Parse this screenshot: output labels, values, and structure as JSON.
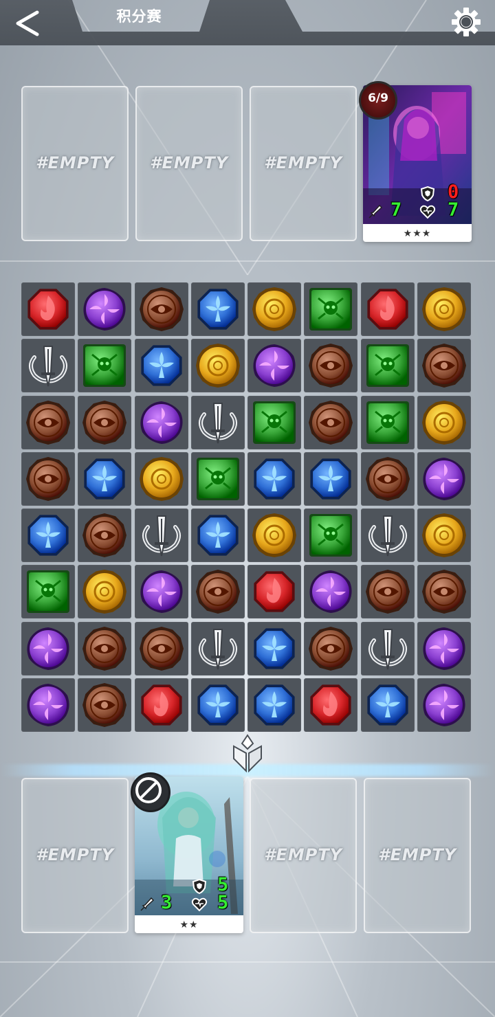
{
  "header": {
    "title": "积分赛"
  },
  "enemy_row": {
    "slots": [
      {
        "type": "empty",
        "label": "#EMPTY"
      },
      {
        "type": "empty",
        "label": "#EMPTY"
      },
      {
        "type": "empty",
        "label": "#EMPTY"
      },
      {
        "type": "card",
        "level": "6/9",
        "shield": "0",
        "attack": "7",
        "hp": "7",
        "stars": "★★★"
      }
    ]
  },
  "player_row": {
    "slots": [
      {
        "type": "empty",
        "label": "#EMPTY"
      },
      {
        "type": "card",
        "status": "disabled",
        "shield": "5",
        "attack": "3",
        "hp": "5",
        "stars": "★★"
      },
      {
        "type": "empty",
        "label": "#EMPTY"
      },
      {
        "type": "empty",
        "label": "#EMPTY"
      }
    ]
  },
  "board": {
    "columns": 8,
    "rows": 8,
    "gems": [
      [
        "red-fire",
        "purple-swirl",
        "brown-eye",
        "blue-flower",
        "yellow-sun",
        "green-skull",
        "red-fire",
        "yellow-sun"
      ],
      [
        "silver-sword",
        "green-skull",
        "blue-flower",
        "yellow-sun",
        "purple-swirl",
        "brown-eye",
        "green-skull",
        "brown-eye"
      ],
      [
        "brown-eye",
        "brown-eye",
        "purple-swirl",
        "silver-sword",
        "green-skull",
        "brown-eye",
        "green-skull",
        "yellow-sun"
      ],
      [
        "brown-eye",
        "blue-flower",
        "yellow-sun",
        "green-skull",
        "blue-flower",
        "blue-flower",
        "brown-eye",
        "purple-swirl"
      ],
      [
        "blue-flower",
        "brown-eye",
        "silver-sword",
        "blue-flower",
        "yellow-sun",
        "green-skull",
        "silver-sword",
        "yellow-sun"
      ],
      [
        "green-skull",
        "yellow-sun",
        "purple-swirl",
        "brown-eye",
        "red-fire",
        "purple-swirl",
        "brown-eye",
        "brown-eye"
      ],
      [
        "purple-swirl",
        "brown-eye",
        "brown-eye",
        "silver-sword",
        "blue-flower",
        "brown-eye",
        "silver-sword",
        "purple-swirl"
      ],
      [
        "purple-swirl",
        "brown-eye",
        "red-fire",
        "blue-flower",
        "blue-flower",
        "red-fire",
        "blue-flower",
        "purple-swirl"
      ]
    ]
  },
  "colors": {
    "red-fire": "#d8262a",
    "purple-swirl": "#8a3fd0",
    "brown-eye": "#8a4d32",
    "blue-flower": "#2f6fd6",
    "yellow-sun": "#e8a81c",
    "green-skull": "#3aa83a",
    "silver-sword": "#c9ced3"
  }
}
